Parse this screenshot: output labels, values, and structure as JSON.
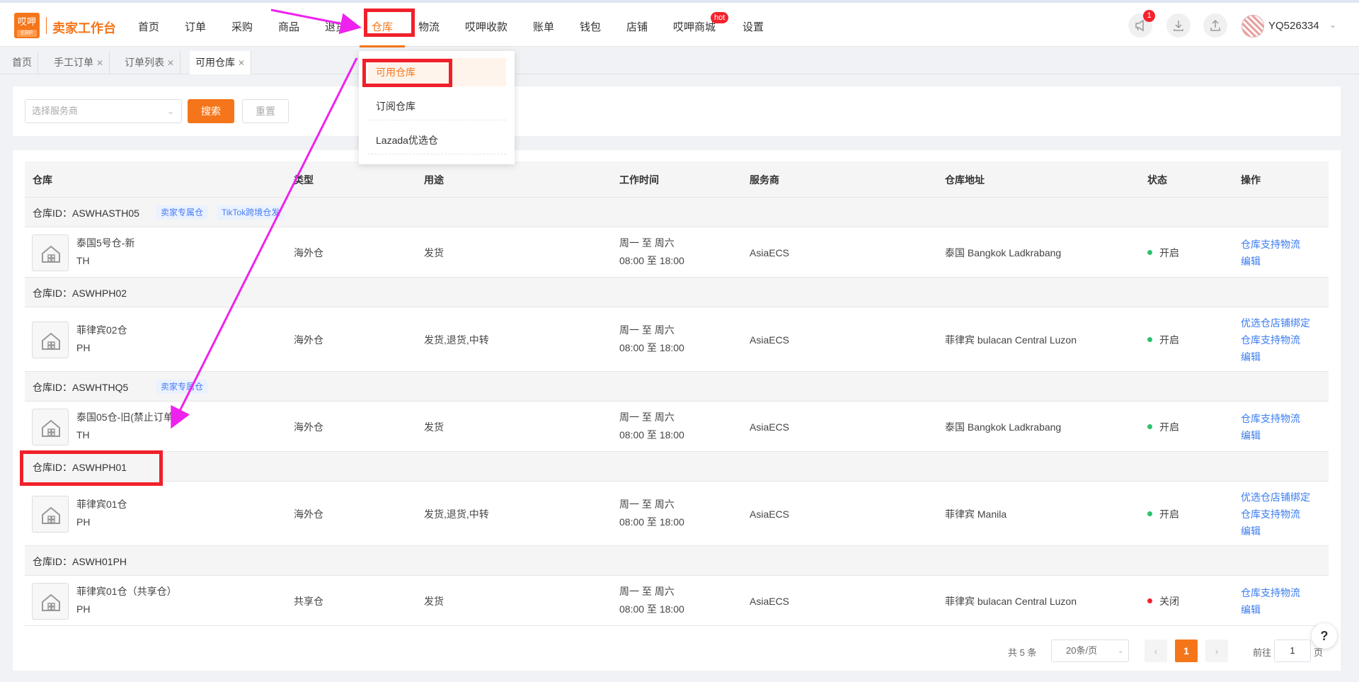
{
  "app": {
    "logo_text": "哎呷",
    "logo_sub": "ERP",
    "title": "卖家工作台"
  },
  "nav": {
    "items": [
      "首页",
      "订单",
      "采购",
      "商品",
      "退货",
      "仓库",
      "物流",
      "哎呷收款",
      "账单",
      "钱包",
      "店铺",
      "哎呷商城",
      "设置"
    ],
    "active": "仓库",
    "hot_badge": "hot"
  },
  "header": {
    "notification_count": "1",
    "username": "YQ526334"
  },
  "tabs": [
    {
      "label": "首页"
    },
    {
      "label": "手工订单"
    },
    {
      "label": "订单列表"
    },
    {
      "label": "可用仓库"
    }
  ],
  "dropdown": {
    "items": [
      "可用仓库",
      "订阅仓库",
      "Lazada优选仓"
    ],
    "active": "可用仓库"
  },
  "filter": {
    "provider_placeholder": "选择服务商",
    "search_label": "搜索",
    "reset_label": "重置"
  },
  "table": {
    "columns": [
      "仓库",
      "类型",
      "用途",
      "工作时间",
      "服务商",
      "仓库地址",
      "状态",
      "操作"
    ],
    "groups": [
      {
        "id_text": "仓库ID：ASWHASTH05",
        "tags": [
          "卖家专属仓",
          "TikTok跨境仓发"
        ],
        "name": "泰国5号仓-新",
        "country": "TH",
        "type": "海外仓",
        "usage": "发货",
        "days": "周一 至 周六",
        "hours": "08:00 至 18:00",
        "provider": "AsiaECS",
        "address": "泰国 Bangkok Ladkrabang",
        "status": "开启",
        "actions": [
          "仓库支持物流",
          "编辑"
        ]
      },
      {
        "id_text": "仓库ID：ASWHPH02",
        "tags": [],
        "name": "菲律宾02仓",
        "country": "PH",
        "type": "海外仓",
        "usage": "发货,退货,中转",
        "days": "周一 至 周六",
        "hours": "08:00 至 18:00",
        "provider": "AsiaECS",
        "address": "菲律宾 bulacan Central Luzon",
        "status": "开启",
        "actions": [
          "优选仓店铺绑定",
          "仓库支持物流",
          "编辑"
        ]
      },
      {
        "id_text": "仓库ID：ASWHTHQ5",
        "tags": [
          "卖家专属仓"
        ],
        "name": "泰国05仓-旧(禁止订单)",
        "country": "TH",
        "type": "海外仓",
        "usage": "发货",
        "days": "周一 至 周六",
        "hours": "08:00 至 18:00",
        "provider": "AsiaECS",
        "address": "泰国 Bangkok Ladkrabang",
        "status": "开启",
        "actions": [
          "仓库支持物流",
          "编辑"
        ]
      },
      {
        "id_text": "仓库ID：ASWHPH01",
        "tags": [],
        "name": "菲律宾01仓",
        "country": "PH",
        "type": "海外仓",
        "usage": "发货,退货,中转",
        "days": "周一 至 周六",
        "hours": "08:00 至 18:00",
        "provider": "AsiaECS",
        "address": "菲律宾 Manila",
        "status": "开启",
        "actions": [
          "优选仓店铺绑定",
          "仓库支持物流",
          "编辑"
        ]
      },
      {
        "id_text": "仓库ID：ASWH01PH",
        "tags": [],
        "name": "菲律宾01仓（共享仓）",
        "country": "PH",
        "type": "共享仓",
        "usage": "发货",
        "days": "周一 至 周六",
        "hours": "08:00 至 18:00",
        "provider": "AsiaECS",
        "address": "菲律宾 bulacan Central Luzon",
        "status": "关闭",
        "actions": [
          "仓库支持物流",
          "编辑"
        ]
      }
    ]
  },
  "pager": {
    "total": "共 5 条",
    "page_size": "20条/页",
    "current": "1",
    "goto_label": "前往",
    "goto_value": "1",
    "goto_suffix": "页"
  },
  "help_label": "?",
  "colors": {
    "brand": "#f5761a",
    "link": "#3a7cf0",
    "status_on": "#2dc26b",
    "status_off": "#f5222d",
    "annotation_box": "#f0202a",
    "annotation_arrow": "#ee22ee"
  }
}
